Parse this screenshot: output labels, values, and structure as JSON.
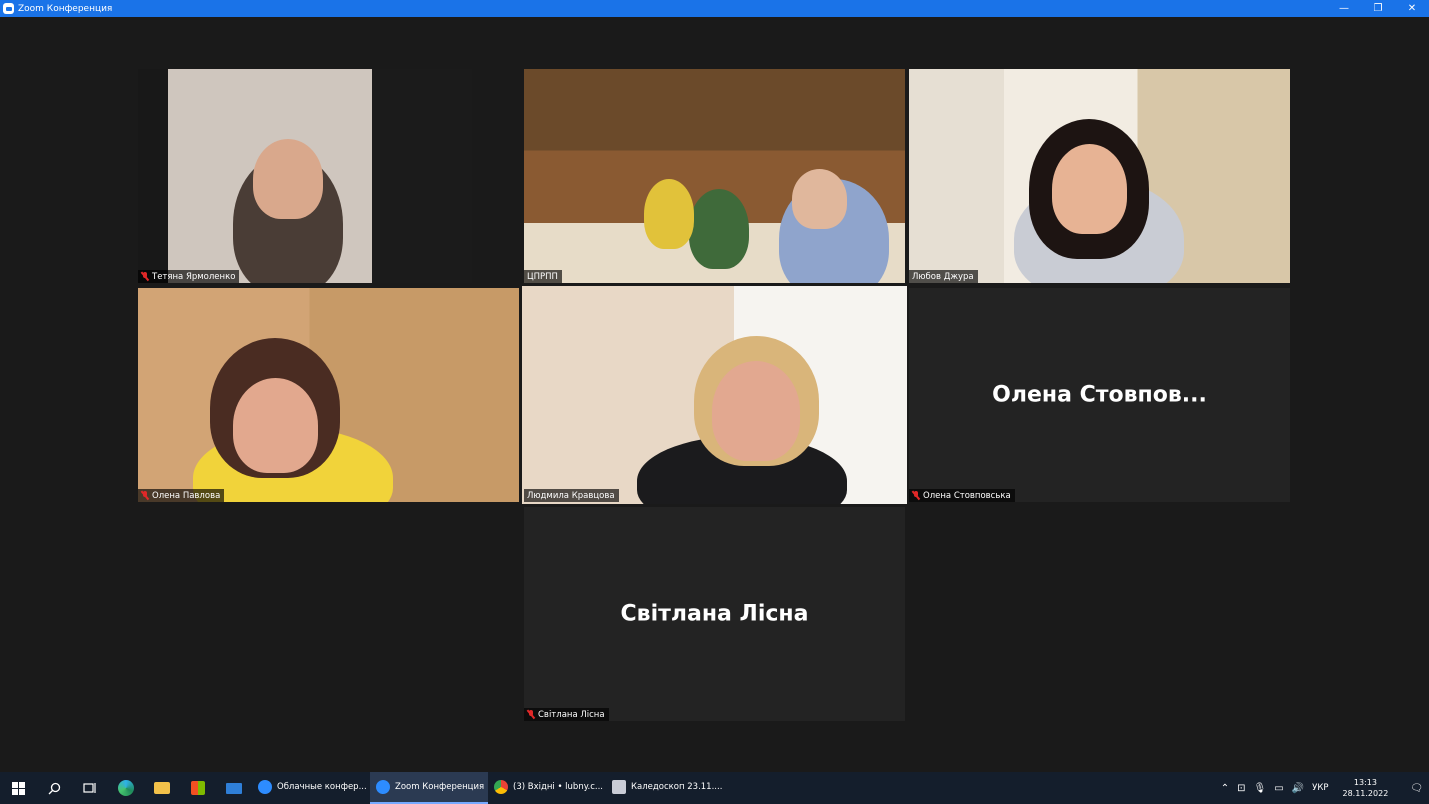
{
  "window": {
    "title": "Zoom Конференция",
    "minimize": "—",
    "maximize": "❐",
    "close": "✕"
  },
  "tiles": [
    {
      "name": "Тетяна Ярмоленко",
      "muted": true,
      "video": true
    },
    {
      "name": "ЦПРПП",
      "muted": false,
      "video": true
    },
    {
      "name": "Любов Джура",
      "muted": false,
      "video": true
    },
    {
      "name": "Олена Павлова",
      "muted": true,
      "video": true
    },
    {
      "name": "Людмила Кравцова",
      "muted": false,
      "video": true,
      "active_speaker": true
    },
    {
      "name": "Олена Стовповська",
      "display_name": "Олена  Стовпов...",
      "muted": true,
      "video": false
    },
    {
      "name": "Світлана Лісна",
      "display_name": "Світлана Лісна",
      "muted": true,
      "video": false
    }
  ],
  "taskbar": {
    "apps": [
      {
        "label": "Облачные конфер...",
        "icon": "zoom-icon",
        "color": "#2d8cff",
        "active": false
      },
      {
        "label": "Zoom Конференция",
        "icon": "zoom-icon",
        "color": "#2d8cff",
        "active": true
      },
      {
        "label": "(3) Вхідні • lubny.c...",
        "icon": "chrome-icon",
        "color": "#e8b830",
        "active": false
      },
      {
        "label": "Каледоскоп 23.11....",
        "icon": "document-icon",
        "color": "#c9ccd6",
        "active": false
      }
    ],
    "language": "УКР",
    "time": "13:13",
    "date": "28.11.2022"
  }
}
